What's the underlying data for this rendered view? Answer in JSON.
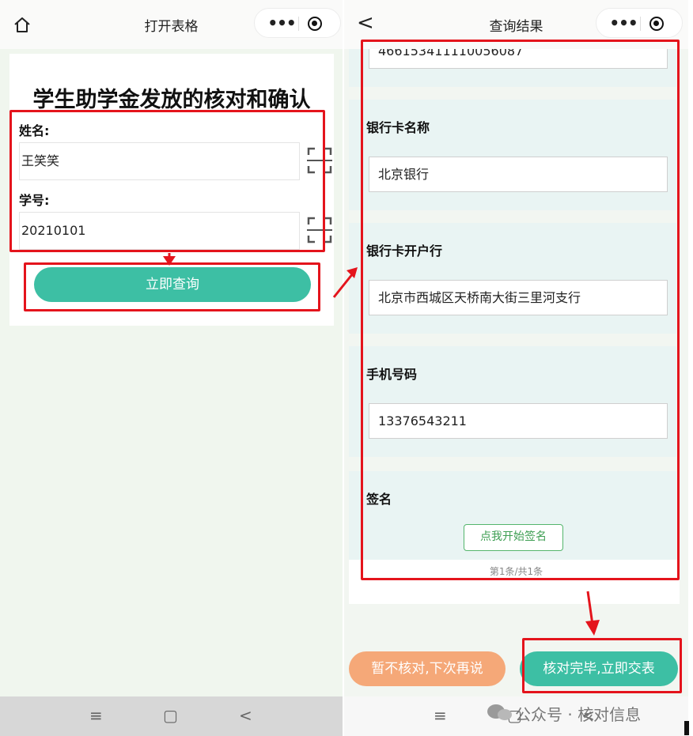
{
  "left_screen": {
    "title": "打开表格",
    "form_heading": "学生助学金发放的核对和确认",
    "fields": [
      {
        "label": "姓名:",
        "value": "王笑笑"
      },
      {
        "label": "学号:",
        "value": "20210101"
      }
    ],
    "query_button": "立即查询"
  },
  "right_screen": {
    "title": "查询结果",
    "card_number_partial": "466153411110056087",
    "sections": [
      {
        "label": "银行卡名称",
        "value": "北京银行"
      },
      {
        "label": "银行卡开户行",
        "value": "北京市西城区天桥南大街三里河支行"
      },
      {
        "label": "手机号码",
        "value": "13376543211"
      }
    ],
    "signature_label": "签名",
    "sign_button": "点我开始签名",
    "pagination": "第1条/共1条",
    "later_button": "暂不核对,下次再说",
    "submit_button": "核对完毕,立即交表"
  },
  "watermark": "公众号 · 核对信息",
  "icons": {
    "home": "home-icon",
    "back": "back-icon",
    "more": "more-dots-icon",
    "close_target": "target-icon",
    "scan": "scan-icon",
    "nav_menu": "≡",
    "nav_home": "▢",
    "nav_back": "<"
  },
  "colors": {
    "accent_green": "#3dbfa4",
    "later_orange": "#f5a878",
    "highlight_red": "#e4141c",
    "section_bg": "#e9f4f3"
  }
}
